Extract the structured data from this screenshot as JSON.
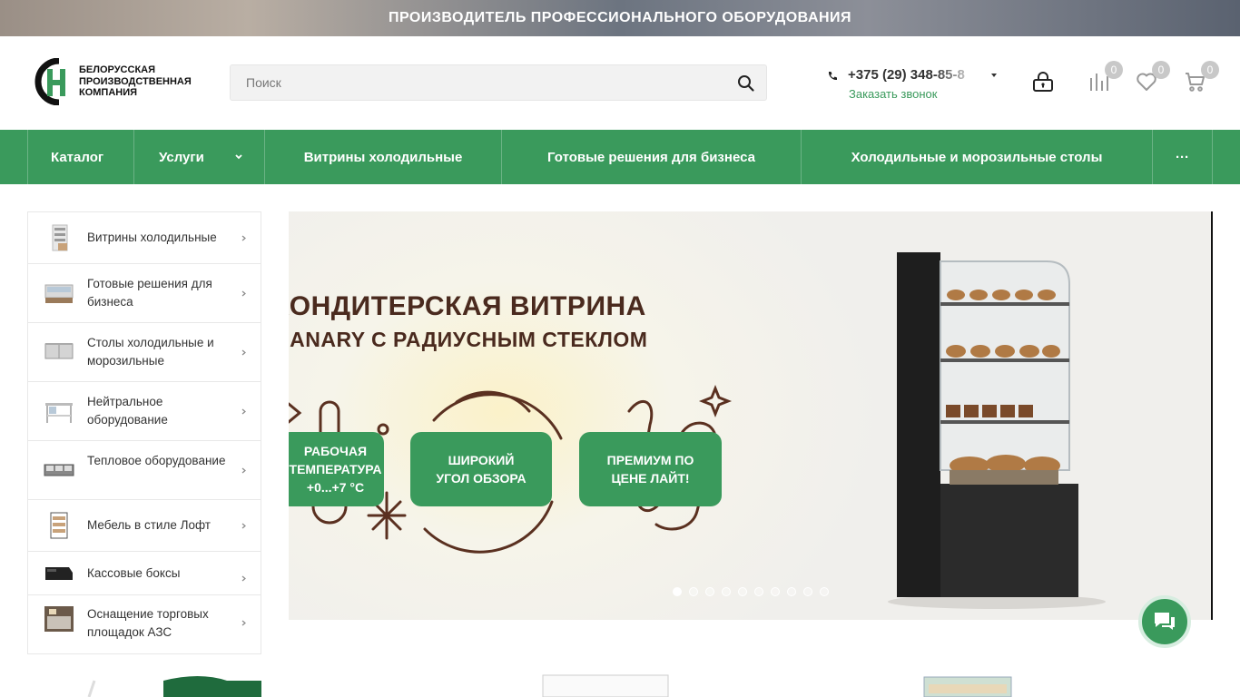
{
  "topbar": {
    "text": "ПРОИЗВОДИТЕЛЬ ПРОФЕССИОНАЛЬНОГО ОБОРУДОВАНИЯ"
  },
  "logo": {
    "line1": "БЕЛОРУССКАЯ",
    "line2": "ПРОИЗВОДСТВЕННАЯ",
    "line3": "КОМПАНИЯ",
    "icon": "bpk-logo-icon"
  },
  "search": {
    "placeholder": "Поиск",
    "value": "",
    "icon": "search-icon"
  },
  "contacts": {
    "phone": "+375 (29) 348-85-8",
    "callback": "Заказать звонок"
  },
  "header_icons": {
    "account": {
      "icon": "lock-user-icon"
    },
    "compare": {
      "icon": "compare-icon",
      "count": "0"
    },
    "favorites": {
      "icon": "heart-icon",
      "count": "0"
    },
    "cart": {
      "icon": "cart-icon",
      "count": "0"
    }
  },
  "nav": {
    "items": [
      {
        "label": "Каталог"
      },
      {
        "label": "Услуги"
      },
      {
        "label": "Витрины холодильные"
      },
      {
        "label": "Готовые решения для бизнеса"
      },
      {
        "label": "Холодильные и морозильные столы"
      }
    ],
    "more": "···"
  },
  "sidebar": {
    "items": [
      {
        "label": "Витрины холодильные"
      },
      {
        "label": "Готовые решения для бизнеса"
      },
      {
        "label": "Столы холодильные и морозильные"
      },
      {
        "label": "Нейтральное оборудование"
      },
      {
        "label": "Тепловое оборудование"
      },
      {
        "label": "Мебель в стиле Лофт"
      },
      {
        "label": "Кассовые боксы"
      },
      {
        "label": "Оснащение торговых площадок АЗС"
      }
    ]
  },
  "hero": {
    "title": "КОНДИТЕРСКАЯ ВИТРИНА",
    "subtitle": "CANARY С РАДИУСНЫМ СТЕКЛОМ",
    "pills": [
      {
        "line1": "РАБОЧАЯ",
        "line2": "ТЕМПЕРАТУРА",
        "line3": "+0...+7 °C"
      },
      {
        "line1": "ШИРОКИЙ",
        "line2": "УГОЛ ОБЗОРА"
      },
      {
        "line1": "ПРЕМИУМ ПО",
        "line2": "ЦЕНЕ ЛАЙТ!"
      }
    ],
    "slides_total": 10,
    "active_slide": 1
  },
  "colors": {
    "brand_green": "#3a9a5c",
    "hero_text": "#4a2a1e",
    "dark": "#333333"
  },
  "chat": {
    "icon": "chat-icon"
  }
}
